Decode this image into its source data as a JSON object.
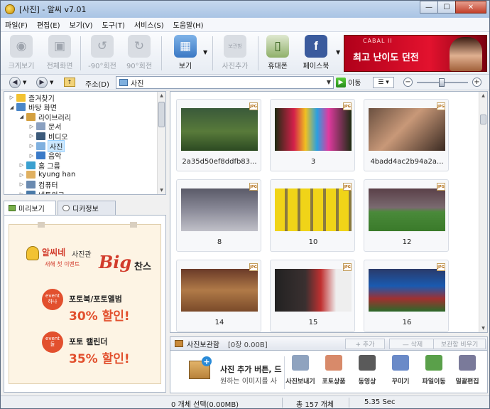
{
  "window": {
    "title": "[사진] - 알씨 v7.01",
    "controls": {
      "minimize": "—",
      "maximize": "☐",
      "close": "✕"
    }
  },
  "menu": [
    "파일(F)",
    "편집(E)",
    "보기(V)",
    "도구(T)",
    "서비스(S)",
    "도움말(H)"
  ],
  "toolbar": {
    "buttons": [
      {
        "label": "크게보기",
        "icon": "magnify-camera-icon",
        "enabled": false
      },
      {
        "label": "전체화면",
        "icon": "film-camera-icon",
        "enabled": false
      },
      {
        "label": "-90°회전",
        "icon": "rotate-left-icon",
        "enabled": false
      },
      {
        "label": "90°회전",
        "icon": "rotate-right-icon",
        "enabled": false
      },
      {
        "label": "보기",
        "icon": "grid-view-icon",
        "enabled": true
      },
      {
        "label": "사진추가",
        "icon": "album-add-icon",
        "enabled": false
      },
      {
        "label": "휴대폰",
        "icon": "phone-icon",
        "enabled": true
      },
      {
        "label": "페이스북",
        "icon": "facebook-icon",
        "enabled": true
      }
    ],
    "album_add_small": "보관함",
    "ad": {
      "logo": "CABAL II",
      "text": "최고 난이도 던전"
    }
  },
  "address": {
    "label": "주소(D)",
    "value": "사진",
    "go_label": "이동",
    "zoom_level": 0.48
  },
  "tree": {
    "items": [
      {
        "label": "즐겨찾기",
        "indent": 0,
        "toggle": "▷",
        "icon_color": "#f2c232"
      },
      {
        "label": "바탕 화면",
        "indent": 0,
        "toggle": "◢",
        "icon_color": "#4a86c8"
      },
      {
        "label": "라이브러리",
        "indent": 1,
        "toggle": "◢",
        "icon_color": "#d4a040"
      },
      {
        "label": "문서",
        "indent": 2,
        "toggle": "▷",
        "icon_color": "#8aa0c0"
      },
      {
        "label": "비디오",
        "indent": 2,
        "toggle": "▷",
        "icon_color": "#3c5a7a"
      },
      {
        "label": "사진",
        "indent": 2,
        "toggle": "▷",
        "icon_color": "#7fb0df",
        "selected": true
      },
      {
        "label": "음악",
        "indent": 2,
        "toggle": "▷",
        "icon_color": "#3a7ac8"
      },
      {
        "label": "홈 그룹",
        "indent": 1,
        "toggle": "▷",
        "icon_color": "#3aa0d0"
      },
      {
        "label": "kyung han",
        "indent": 1,
        "toggle": "▷",
        "icon_color": "#e0b060"
      },
      {
        "label": "컴퓨터",
        "indent": 1,
        "toggle": "▷",
        "icon_color": "#6a8ab0"
      },
      {
        "label": "네트워크",
        "indent": 1,
        "toggle": "▷",
        "icon_color": "#4a7aa8"
      }
    ]
  },
  "preview": {
    "tabs": [
      "미리보기",
      "디카정보"
    ],
    "promo": {
      "brand": "알씨네",
      "brand2": "사진관",
      "event": "새해 첫 이벤트",
      "big": "Big",
      "chance": "찬스",
      "badge1": [
        "event",
        "하나"
      ],
      "line1": "포토북/포토앨범",
      "deal1": "30% 할인!",
      "badge2": [
        "event",
        "둘"
      ],
      "line2": "포토 캘린더",
      "deal2": "35% 할인!"
    }
  },
  "thumbnails": [
    {
      "caption": "2a35d50ef8ddfb83...",
      "scene": "soccer-player-field"
    },
    {
      "caption": "3",
      "scene": "colorful-cleats"
    },
    {
      "caption": "4badd4ac2b94a2a...",
      "scene": "portrait-man"
    },
    {
      "caption": "8",
      "scene": "stadium-celebration"
    },
    {
      "caption": "10",
      "scene": "yellow-jerseys-lockers"
    },
    {
      "caption": "12",
      "scene": "corner-kick"
    },
    {
      "caption": "14",
      "scene": "stadium-crowd-player"
    },
    {
      "caption": "15",
      "scene": "player-reading"
    },
    {
      "caption": "16",
      "scene": "estro-player"
    }
  ],
  "album": {
    "title": "사진보관함",
    "count": "[0장 0.00B]",
    "buttons": [
      "+ 추가",
      "— 삭제",
      "보관함 비우기"
    ],
    "hint_title": "사진 추가 버튼, 드",
    "hint_body": "원하는 이미지를 사",
    "actions": [
      {
        "label": "사진보내기",
        "icon": "send-photo-icon"
      },
      {
        "label": "포토상품",
        "icon": "photo-goods-icon"
      },
      {
        "label": "동영상",
        "icon": "video-icon"
      },
      {
        "label": "꾸미기",
        "icon": "decorate-icon"
      },
      {
        "label": "파일이동",
        "icon": "move-file-icon"
      },
      {
        "label": "일괄편집",
        "icon": "batch-edit-icon"
      }
    ]
  },
  "status": {
    "selection": "0 개체 선택(0.00MB)",
    "total": "총 157 개체",
    "time": "5.35 Sec"
  }
}
